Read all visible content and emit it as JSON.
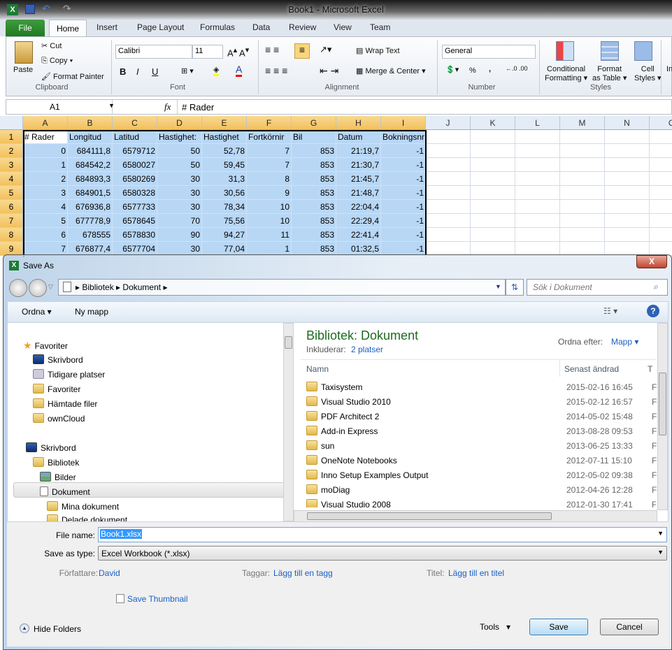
{
  "excel": {
    "title": "Book1  -  Microsoft Excel",
    "tabs": [
      "File",
      "Home",
      "Insert",
      "Page Layout",
      "Formulas",
      "Data",
      "Review",
      "View",
      "Team"
    ],
    "ribbon": {
      "clipboard": {
        "paste": "Paste",
        "cut": "Cut",
        "copy": "Copy",
        "format_painter": "Format Painter",
        "label": "Clipboard"
      },
      "font": {
        "name": "Calibri",
        "size": "11",
        "bold": "B",
        "italic": "I",
        "underline": "U",
        "label": "Font"
      },
      "alignment": {
        "wrap_text": "Wrap Text",
        "merge_center": "Merge & Center",
        "label": "Alignment"
      },
      "number": {
        "format": "General",
        "percent": "%",
        "comma": ",",
        "label": "Number"
      },
      "styles": {
        "conditional": "Conditional",
        "conditional2": "Formatting",
        "format_table": "Format",
        "format_table2": "as Table",
        "cell_styles": "Cell",
        "cell_styles2": "Styles",
        "label": "Styles"
      },
      "insert_partial": "In"
    },
    "name_box": "A1",
    "fx": "fx",
    "formula": "# Rader",
    "columns": [
      "A",
      "B",
      "C",
      "D",
      "E",
      "F",
      "G",
      "H",
      "I",
      "J",
      "K",
      "L",
      "M",
      "N",
      "O"
    ],
    "rows": [
      [
        "# Rader",
        "Longitud",
        "Latitud",
        "Hastighet:",
        "Hastighet",
        "Fortkörnir",
        "Bil",
        "Datum",
        "Bokningsnr"
      ],
      [
        "0",
        "684111,8",
        "6579712",
        "50",
        "52,78",
        "7",
        "853",
        "21:19,7",
        "-1"
      ],
      [
        "1",
        "684542,2",
        "6580027",
        "50",
        "59,45",
        "7",
        "853",
        "21:30,7",
        "-1"
      ],
      [
        "2",
        "684893,3",
        "6580269",
        "30",
        "31,3",
        "8",
        "853",
        "21:45,7",
        "-1"
      ],
      [
        "3",
        "684901,5",
        "6580328",
        "30",
        "30,56",
        "9",
        "853",
        "21:48,7",
        "-1"
      ],
      [
        "4",
        "676936,8",
        "6577733",
        "30",
        "78,34",
        "10",
        "853",
        "22:04,4",
        "-1"
      ],
      [
        "5",
        "677778,9",
        "6578645",
        "70",
        "75,56",
        "10",
        "853",
        "22:29,4",
        "-1"
      ],
      [
        "6",
        "678555",
        "6578830",
        "90",
        "94,27",
        "11",
        "853",
        "22:41,4",
        "-1"
      ],
      [
        "7",
        "676877,4",
        "6577704",
        "30",
        "77,04",
        "1",
        "853",
        "01:32,5",
        "-1"
      ]
    ]
  },
  "dialog": {
    "title": "Save As",
    "close": "X",
    "breadcrumb": [
      "Bibliotek",
      "Dokument"
    ],
    "search_placeholder": "Sök i Dokument",
    "organize": "Ordna ▾",
    "new_folder": "Ny mapp",
    "nav": {
      "favorites": "Favoriter",
      "fav_items": [
        "Skrivbord",
        "Tidigare platser",
        "Favoriter",
        "Hämtade filer",
        "ownCloud"
      ],
      "desktop": "Skrivbord",
      "libraries": "Bibliotek",
      "lib_items": [
        "Bilder",
        "Dokument"
      ],
      "doc_items": [
        "Mina dokument",
        "Delade dokument"
      ]
    },
    "library_title": "Bibliotek: Dokument",
    "includes_label": "Inkluderar:",
    "includes_link": "2 platser",
    "arrange_label": "Ordna efter:",
    "arrange_value": "Mapp",
    "col_name": "Namn",
    "col_modified": "Senast ändrad",
    "col_type": "T",
    "files": [
      {
        "name": "Taxisystem",
        "date": "2015-02-16 16:45",
        "type": "F"
      },
      {
        "name": "Visual Studio 2010",
        "date": "2015-02-12 16:57",
        "type": "F"
      },
      {
        "name": "PDF Architect 2",
        "date": "2014-05-02 15:48",
        "type": "F"
      },
      {
        "name": "Add-in Express",
        "date": "2013-08-28 09:53",
        "type": "F"
      },
      {
        "name": "sun",
        "date": "2013-06-25 13:33",
        "type": "F"
      },
      {
        "name": "OneNote Notebooks",
        "date": "2012-07-11 15:10",
        "type": "F"
      },
      {
        "name": "Inno Setup Examples Output",
        "date": "2012-05-02 09:38",
        "type": "F"
      },
      {
        "name": "moDiag",
        "date": "2012-04-26 12:28",
        "type": "F"
      },
      {
        "name": "Visual Studio 2008",
        "date": "2012-01-30 17:41",
        "type": "F"
      }
    ],
    "file_name_label": "File name:",
    "file_name": "Book1.xlsx",
    "save_type_label": "Save as type:",
    "save_type": "Excel Workbook (*.xlsx)",
    "author_label": "Författare:",
    "author": "David",
    "tags_label": "Taggar:",
    "tags": "Lägg till en tagg",
    "title_label": "Titel:",
    "title_value": "Lägg till en titel",
    "thumbnail": "Save Thumbnail",
    "hide_folders": "Hide Folders",
    "tools": "Tools",
    "save": "Save",
    "cancel": "Cancel"
  }
}
